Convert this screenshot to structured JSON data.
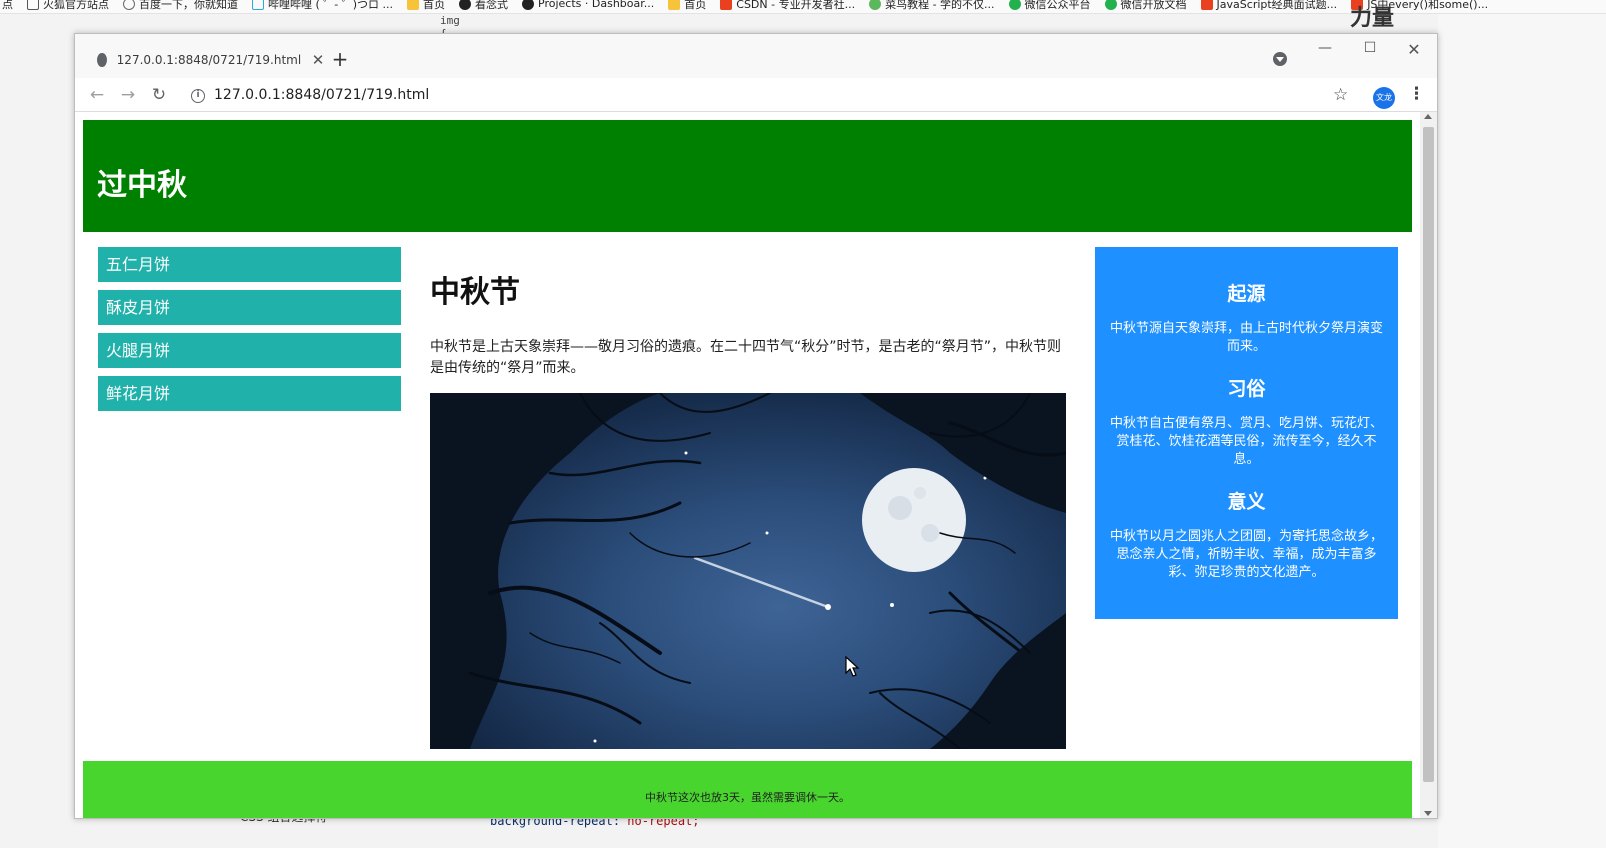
{
  "bookmarks": [
    {
      "label": "点",
      "icon": "folder-icon"
    },
    {
      "label": "火狐官方站点",
      "icon": "page-icon"
    },
    {
      "label": "百度一下，你就知道",
      "icon": "globe-icon"
    },
    {
      "label": "哔哩哔哩 ( ゜- ゜)つロ ...",
      "icon": "bilibili-icon"
    },
    {
      "label": "首页",
      "icon": "folder-icon"
    },
    {
      "label": "看念式",
      "icon": "tiktok-icon"
    },
    {
      "label": "Projects · Dashboar...",
      "icon": "tiktok-icon"
    },
    {
      "label": "首页",
      "icon": "folder-icon"
    },
    {
      "label": "CSDN - 专业开发者社...",
      "icon": "csdn-icon"
    },
    {
      "label": "菜鸟教程 - 学的不仅...",
      "icon": "runoob-icon"
    },
    {
      "label": "微信公众平台",
      "icon": "wechat-icon"
    },
    {
      "label": "微信开放文档",
      "icon": "wechat-icon"
    },
    {
      "label": "JavaScript经典面试题...",
      "icon": "bookmark-icon"
    },
    {
      "label": "JS中every()和some()...",
      "icon": "bookmark-icon"
    }
  ],
  "background": {
    "editor_top": "img {",
    "right_text": "力量",
    "bottom_left": "CSS 组合选择符",
    "bottom_code_prop": "background-repeat:",
    "bottom_code_value": "no-repeat;"
  },
  "browser": {
    "tab_title": "127.0.0.1:8848/0721/719.html",
    "url": "127.0.0.1:8848/0721/719.html",
    "avatar_text": "文龙"
  },
  "page": {
    "header_title": "过中秋",
    "nav_items": [
      {
        "label": "五仁月饼"
      },
      {
        "label": "酥皮月饼"
      },
      {
        "label": "火腿月饼"
      },
      {
        "label": "鲜花月饼"
      }
    ],
    "article": {
      "title": "中秋节",
      "text": "中秋节是上古天象崇拜——敬月习俗的遗痕。在二十四节气“秋分”时节，是古老的“祭月节”，中秋节则是由传统的“祭月”而来。"
    },
    "sidebar": [
      {
        "heading": "起源",
        "text": "中秋节源自天象崇拜，由上古时代秋夕祭月演变而来。"
      },
      {
        "heading": "习俗",
        "text": "中秋节自古便有祭月、赏月、吃月饼、玩花灯、赏桂花、饮桂花酒等民俗，流传至今，经久不息。"
      },
      {
        "heading": "意义",
        "text": "中秋节以月之圆兆人之团圆，为寄托思念故乡，思念亲人之情，祈盼丰收、幸福，成为丰富多彩、弥足珍贵的文化遗产。"
      }
    ],
    "footer_text": "中秋节这次也放3天，虽然需要调休一天。"
  },
  "colors": {
    "header": "#008000",
    "nav_item": "#20b2aa",
    "sidebar": "#1e90ff",
    "footer": "#48d52e"
  }
}
